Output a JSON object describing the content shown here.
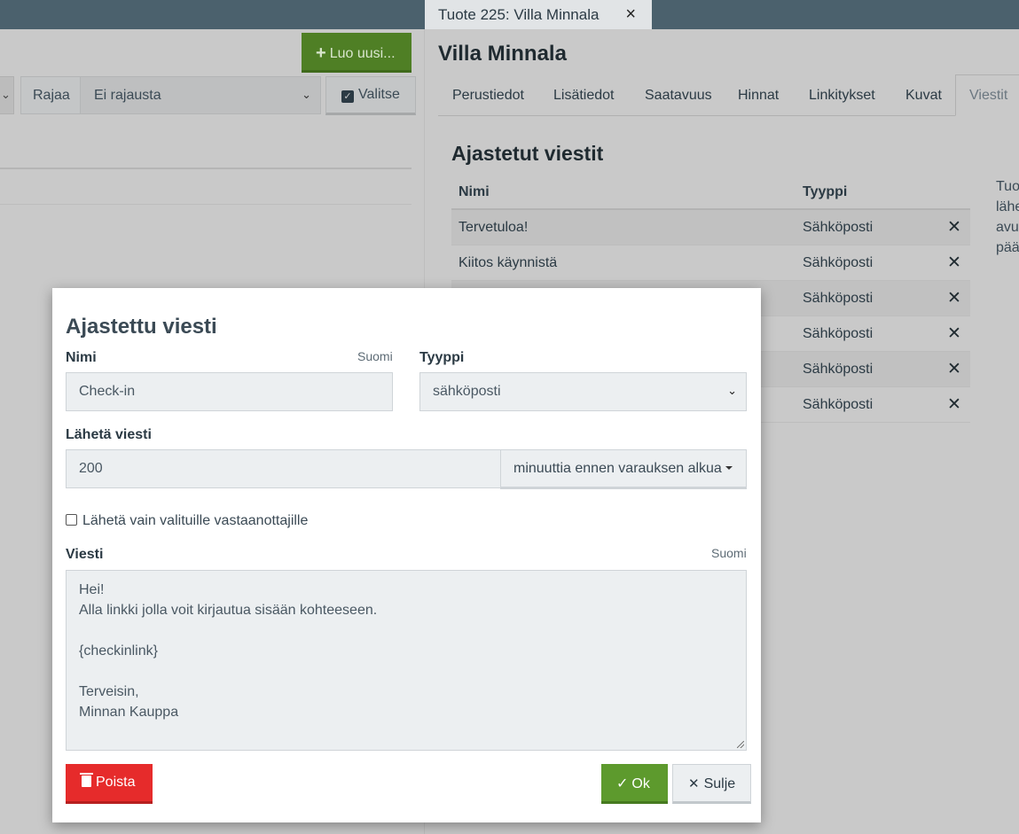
{
  "doc_tab": {
    "title": "Tuote 225: Villa Minnala",
    "close_icon": "×"
  },
  "left": {
    "new_button": {
      "icon": "plus-icon",
      "label": "Luo uusi..."
    },
    "filter": {
      "label": "Rajaa",
      "value": "Ei rajausta"
    },
    "select_button": {
      "icon": "checkbox-icon",
      "label": "Valitse"
    }
  },
  "product": {
    "title": "Villa Minnala",
    "tabs": [
      {
        "label": "Perustiedot"
      },
      {
        "label": "Lisätiedot"
      },
      {
        "label": "Saatavuus"
      },
      {
        "label": "Hinnat"
      },
      {
        "label": "Linkitykset"
      },
      {
        "label": "Kuvat"
      },
      {
        "label": "Viestit",
        "active": true
      }
    ],
    "section_title": "Ajastetut viestit",
    "table": {
      "headers": {
        "name": "Nimi",
        "type": "Tyyppi"
      },
      "rows": [
        {
          "name": "Tervetuloa!",
          "type": "Sähköposti"
        },
        {
          "name": "Kiitos käynnistä",
          "type": "Sähköposti"
        },
        {
          "name": "",
          "type": "Sähköposti"
        },
        {
          "name": "",
          "type": "Sähköposti"
        },
        {
          "name": "",
          "type": "Sähköposti"
        },
        {
          "name": "",
          "type": "Sähköposti"
        }
      ]
    },
    "side_text": [
      "Tuo",
      "lähe",
      "avu",
      "pää"
    ]
  },
  "modal": {
    "title": "Ajastettu viesti",
    "name_label": "Nimi",
    "name_lang": "Suomi",
    "name_value": "Check-in",
    "type_label": "Tyyppi",
    "type_value": "sähköposti",
    "send_label": "Lähetä viesti",
    "send_value": "200",
    "send_unit": "minuuttia ennen varauksen alkua",
    "only_selected_label": "Lähetä vain valituille vastaanottajille",
    "only_selected_checked": false,
    "message_label": "Viesti",
    "message_lang": "Suomi",
    "message_lines": [
      "Hei!",
      "Alla linkki jolla voit kirjautua sisään kohteeseen.",
      "",
      "{checkinlink}",
      "",
      "Terveisin,",
      "Minnan Kauppa"
    ],
    "delete_label": "Poista",
    "ok_label": "Ok",
    "close_label": "Sulje"
  },
  "colors": {
    "primary_green": "#5d9a2d",
    "danger_red": "#e62b2b",
    "topbar": "#4b616d"
  }
}
